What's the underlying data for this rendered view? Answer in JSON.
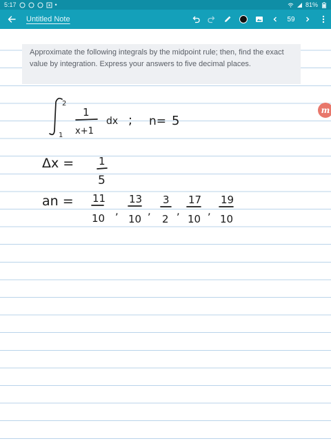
{
  "status_bar": {
    "time": "5:17",
    "battery": "81%",
    "icons": [
      "notification-icon",
      "notification-icon",
      "notification-icon",
      "screenshot-icon",
      "wifi-icon",
      "signal-icon",
      "battery-icon"
    ]
  },
  "toolbar": {
    "title": "Untitled Note",
    "page_number": "59",
    "pen_color": "#111111",
    "icons": [
      "back-arrow-icon",
      "undo-icon",
      "redo-icon",
      "pen-icon",
      "color-dot",
      "image-icon",
      "chevron-left-icon",
      "chevron-right-icon",
      "more-vert-icon"
    ]
  },
  "colors": {
    "toolbar": "#14a0ba",
    "status_bar": "#0f8ea6",
    "ruled_line": "#b9d3ea",
    "question_bg": "#eef0f3",
    "side_tab": "#e8776b"
  },
  "question": {
    "text": "Approximate the following integrals by the midpoint rule; then, find the exact value by integration. Express your answers to five decimal places."
  },
  "side_tab": {
    "label": "m"
  },
  "handwriting": {
    "lower_limit": "1",
    "upper_limit": "2",
    "integrand_numerator": "1",
    "integrand_denominator": "x+1",
    "differential": "dx",
    "separator": ";",
    "n_label": "n=",
    "n_value": "5",
    "delta_x_label": "Δx =",
    "delta_x_numerator": "1",
    "delta_x_denominator": "5",
    "a_n_label": "an =",
    "midpoints": [
      {
        "numerator": "11",
        "denominator": "10"
      },
      {
        "numerator": "13",
        "denominator": "10"
      },
      {
        "numerator": "3",
        "denominator": "2"
      },
      {
        "numerator": "17",
        "denominator": "10"
      },
      {
        "numerator": "19",
        "denominator": "10"
      }
    ],
    "comma": ","
  }
}
